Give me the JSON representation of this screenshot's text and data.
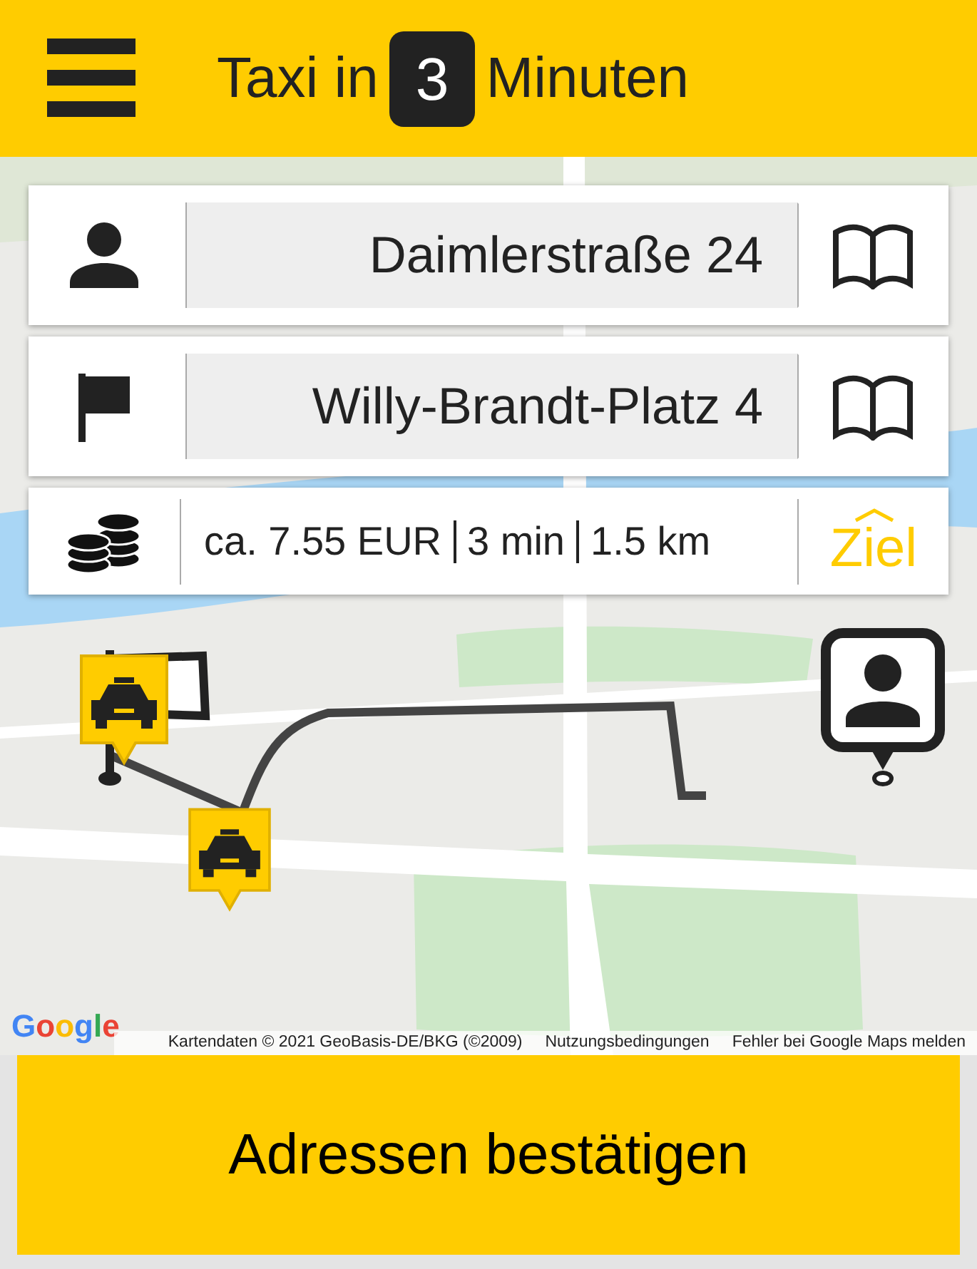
{
  "header": {
    "title_before": "Taxi in",
    "minutes": "3",
    "title_after": "Minuten"
  },
  "addresses": [
    {
      "kind": "pickup",
      "value": "Daimlerstraße 24"
    },
    {
      "kind": "destination",
      "value": "Willy-Brandt-Platz 4"
    }
  ],
  "trip": {
    "fare": "ca. 7.55 EUR",
    "duration": "3 min",
    "distance": "1.5 km",
    "target_button": "Ziel"
  },
  "map": {
    "kind": "picture",
    "logo": "Google",
    "attribution": [
      "Kartendaten © 2021 GeoBasis-DE/BKG (©2009)",
      "Nutzungsbedingungen",
      "Fehler bei Google Maps melden"
    ]
  },
  "confirm_button": "Adressen bestätigen"
}
